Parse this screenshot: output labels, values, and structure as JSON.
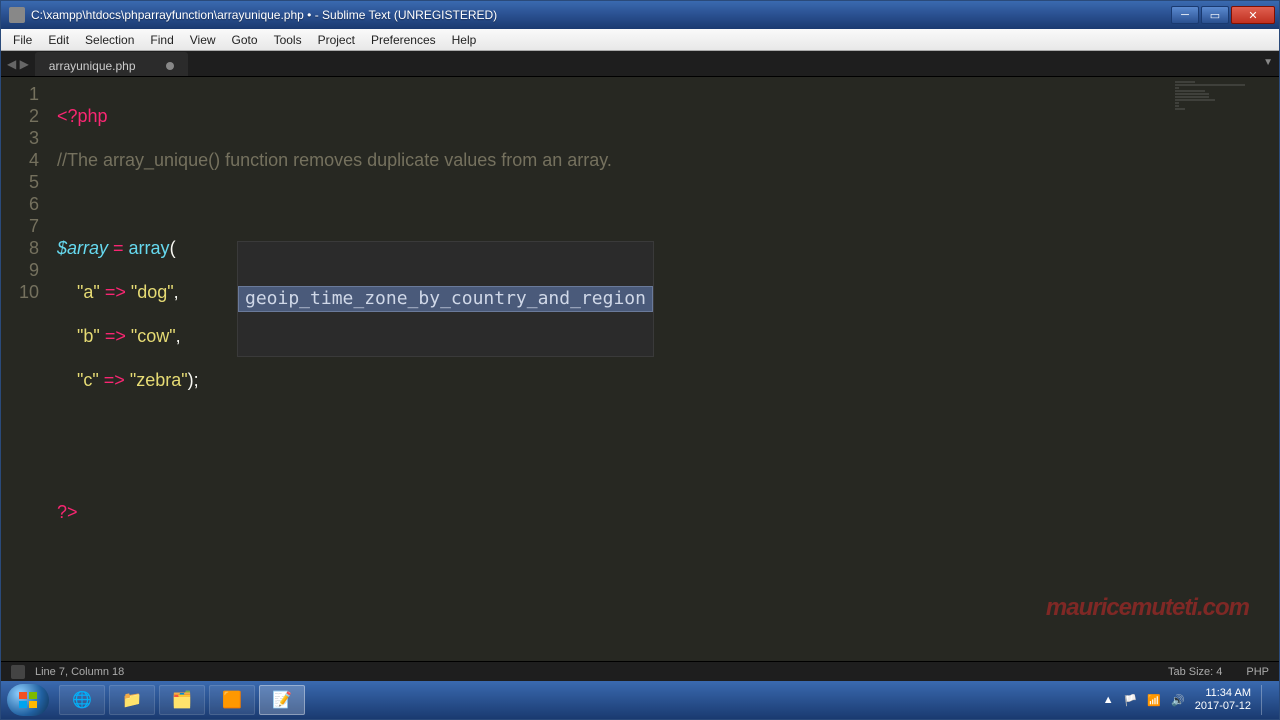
{
  "titlebar": {
    "text": "C:\\xampp\\htdocs\\phparrayfunction\\arrayunique.php • - Sublime Text (UNREGISTERED)"
  },
  "menu": {
    "file": "File",
    "edit": "Edit",
    "selection": "Selection",
    "find": "Find",
    "view": "View",
    "goto": "Goto",
    "tools": "Tools",
    "project": "Project",
    "preferences": "Preferences",
    "help": "Help"
  },
  "tabs": {
    "active": "arrayunique.php"
  },
  "code": {
    "lines": [
      "1",
      "2",
      "3",
      "4",
      "5",
      "6",
      "7",
      "8",
      "9",
      "10"
    ],
    "l1_open": "<?php",
    "l2_comment": "//The array_unique() function removes duplicate values from an array.",
    "l4_var": "$array",
    "l4_eq": " = ",
    "l4_func": "array",
    "l4_paren": "(",
    "l5_key": "\"a\"",
    "l5_arrow": " => ",
    "l5_val": "\"dog\"",
    "l5_comma": ",",
    "l6_key": "\"b\"",
    "l6_arrow": " => ",
    "l6_val": "\"cow\"",
    "l6_comma": ",",
    "l7_key": "\"c\"",
    "l7_arrow": " => ",
    "l7_val": "\"zebra\"",
    "l7_close": ");",
    "l10_close": "?>"
  },
  "autocomplete": {
    "item0": "geoip_time_zone_by_country_and_region"
  },
  "status": {
    "position": "Line 7, Column 18",
    "tabsize": "Tab Size: 4",
    "syntax": "PHP"
  },
  "watermark": "mauricemuteti.com",
  "tray": {
    "time": "11:34 AM",
    "date": "2017-07-12"
  }
}
